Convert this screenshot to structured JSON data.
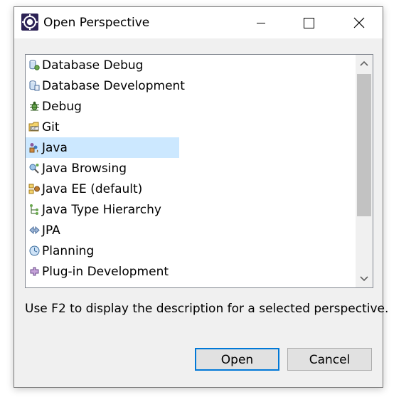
{
  "window": {
    "title": "Open Perspective",
    "controls": [
      "minimize",
      "maximize",
      "close"
    ]
  },
  "perspectives": {
    "selected_index": 4,
    "items": [
      {
        "label": "Database Debug",
        "icon": "database-debug-icon"
      },
      {
        "label": "Database Development",
        "icon": "database-development-icon"
      },
      {
        "label": "Debug",
        "icon": "debug-bug-icon"
      },
      {
        "label": "Git",
        "icon": "git-icon"
      },
      {
        "label": "Java",
        "icon": "java-icon"
      },
      {
        "label": "Java Browsing",
        "icon": "java-browsing-icon"
      },
      {
        "label": "Java EE (default)",
        "icon": "java-ee-icon"
      },
      {
        "label": "Java Type Hierarchy",
        "icon": "type-hierarchy-icon"
      },
      {
        "label": "JPA",
        "icon": "jpa-icon"
      },
      {
        "label": "Planning",
        "icon": "planning-icon"
      },
      {
        "label": "Plug-in Development",
        "icon": "plugin-development-icon"
      }
    ]
  },
  "hint": "Use F2 to display the description for a selected perspective.",
  "buttons": {
    "open": "Open",
    "cancel": "Cancel"
  },
  "colors": {
    "selection": "#cce8ff",
    "default_button_border": "#0078d7",
    "dialog_background": "#f0f0f0"
  }
}
